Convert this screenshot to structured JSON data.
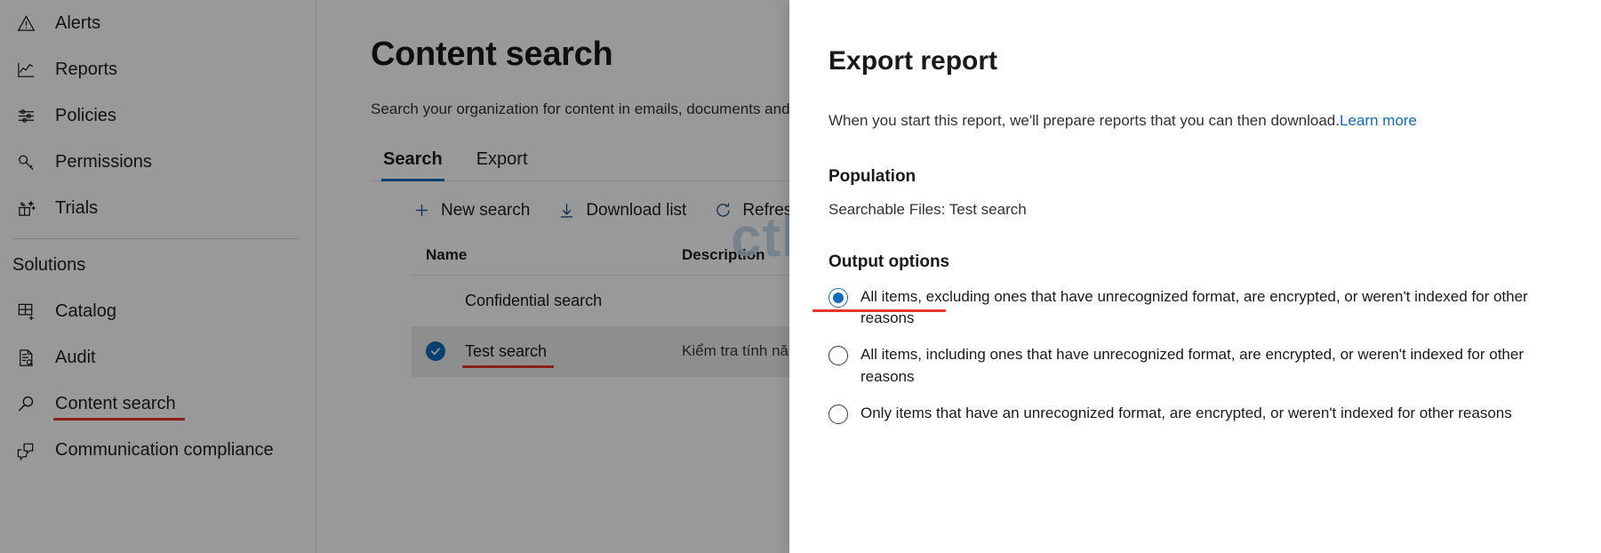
{
  "sidebar": {
    "items_top": [
      {
        "label": "Alerts",
        "icon": "alert-triangle-icon"
      },
      {
        "label": "Reports",
        "icon": "chart-line-icon"
      },
      {
        "label": "Policies",
        "icon": "sliders-icon"
      },
      {
        "label": "Permissions",
        "icon": "key-icon"
      },
      {
        "label": "Trials",
        "icon": "gift-sparkle-icon"
      }
    ],
    "section_title": "Solutions",
    "items_solutions": [
      {
        "label": "Catalog",
        "icon": "grid-plus-icon",
        "annotated": false
      },
      {
        "label": "Audit",
        "icon": "document-search-icon",
        "annotated": false
      },
      {
        "label": "Content search",
        "icon": "magnifier-icon",
        "annotated": true
      },
      {
        "label": "Communication compliance",
        "icon": "chat-bubbles-icon",
        "annotated": false
      }
    ]
  },
  "main": {
    "page_title": "Content search",
    "page_description": "Search your organization for content in emails, documents and search results.",
    "tabs": [
      {
        "label": "Search",
        "active": true
      },
      {
        "label": "Export",
        "active": false
      }
    ],
    "toolbar": [
      {
        "label": "New search",
        "icon": "plus-icon"
      },
      {
        "label": "Download list",
        "icon": "download-arrow-icon"
      },
      {
        "label": "Refresh",
        "icon": "refresh-circle-icon"
      }
    ],
    "table": {
      "columns": [
        "Name",
        "Description"
      ],
      "rows": [
        {
          "name": "Confidential search",
          "description": "",
          "selected": false,
          "annotated": false
        },
        {
          "name": "Test search",
          "description": "Kiểm tra tính năng t",
          "selected": true,
          "annotated": true
        }
      ]
    },
    "watermark": "ctl.edu.vn"
  },
  "panel": {
    "title": "Export report",
    "intro_text": "When you start this report, we'll prepare reports that you can then download.",
    "intro_link": "Learn more",
    "population_title": "Population",
    "population_value": "Searchable Files: Test search",
    "output_title": "Output options",
    "output_options": [
      {
        "label": "All items, excluding ones that have unrecognized format, are encrypted, or weren't indexed for other reasons",
        "checked": true,
        "annotated": true
      },
      {
        "label": "All items, including ones that have unrecognized format, are encrypted, or weren't indexed for other reasons",
        "checked": false,
        "annotated": false
      },
      {
        "label": "Only items that have an unrecognized format, are encrypted, or weren't indexed for other reasons",
        "checked": false,
        "annotated": false
      }
    ]
  },
  "colors": {
    "accent": "#0f6cbd",
    "annotation_red": "#e8352c",
    "text_primary": "#1b1a19",
    "watermark": "#b9d5ea"
  }
}
